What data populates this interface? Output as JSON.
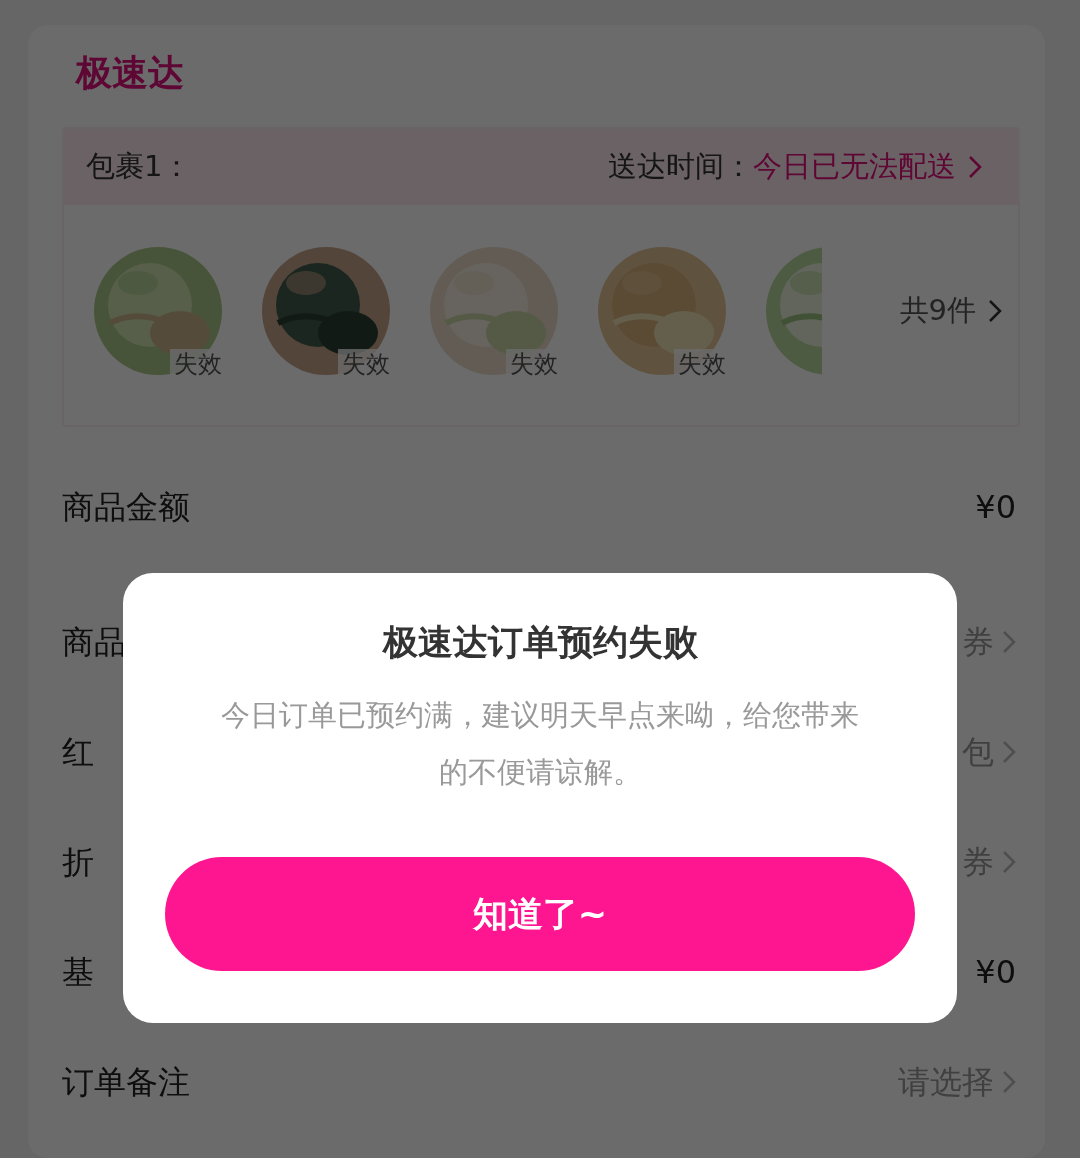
{
  "order": {
    "title": "极速达",
    "package": {
      "label": "包裹1：",
      "delivery_label": "送达时间：",
      "delivery_value": "今日已无法配送",
      "count": "共9件",
      "items": [
        {
          "kind": "picture",
          "tag": "失效"
        },
        {
          "kind": "picture",
          "tag": "失效"
        },
        {
          "kind": "picture",
          "tag": "失效"
        },
        {
          "kind": "picture",
          "tag": "失效"
        },
        {
          "kind": "picture",
          "cut": true
        }
      ]
    },
    "rows": [
      {
        "label": "商品金额",
        "value": "¥0",
        "muted": false,
        "chevron": false
      },
      {
        "label": "商品",
        "value": "券",
        "muted": true,
        "chevron": true
      },
      {
        "label": "红",
        "value": "包",
        "muted": true,
        "chevron": true
      },
      {
        "label": "折",
        "value": "券",
        "muted": true,
        "chevron": true
      },
      {
        "label": "基",
        "value": "¥0",
        "muted": false,
        "chevron": false
      },
      {
        "label": "订单备注",
        "value": "请选择",
        "muted": true,
        "chevron": true
      }
    ]
  },
  "dialog": {
    "title": "极速达订单预约失败",
    "message": "今日订单已预约满，建议明天早点来呦，给您带来的不便请谅解。",
    "button": "知道了~"
  }
}
